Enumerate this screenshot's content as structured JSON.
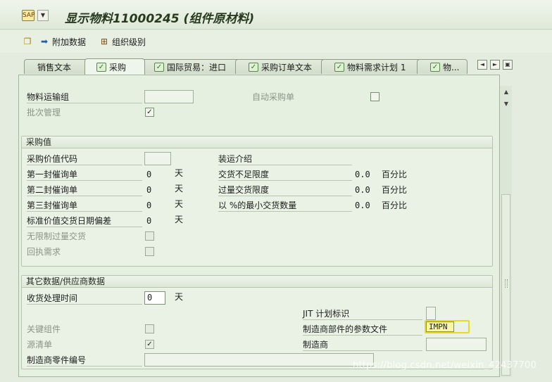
{
  "window": {
    "title": "显示物料11000245 (组件原材料)",
    "sys_icon": "sap-screen-icon",
    "sys_icon_glyph": "SAP"
  },
  "toolbar": {
    "items": [
      {
        "label": "",
        "icon": "copy-icon"
      },
      {
        "label": "附加数据",
        "icon": "arrow-right-icon"
      },
      {
        "label": "组织级别",
        "icon": "org-levels-icon"
      }
    ]
  },
  "tabs": [
    {
      "label": "销售文本",
      "checked": false
    },
    {
      "label": "采购",
      "checked": true,
      "active": true
    },
    {
      "label": "国际贸易：进口",
      "checked": true
    },
    {
      "label": "采购订单文本",
      "checked": true
    },
    {
      "label": "物料需求计划 1",
      "checked": true
    },
    {
      "label": "物...",
      "checked": true
    }
  ],
  "tab_nav": {
    "prev": "◄",
    "next": "►",
    "list": "▣"
  },
  "top_section": {
    "material_freight_group": {
      "label": "物料运输组",
      "value": ""
    },
    "auto_po": {
      "label": "自动采购单",
      "checked": false
    },
    "batch_mgmt": {
      "label": "批次管理",
      "checked": true
    }
  },
  "purchasing_values": {
    "title": "采购值",
    "pur_value_key": {
      "label": "采购价值代码",
      "value": ""
    },
    "reminder1": {
      "label": "第一封催询单",
      "value": "0",
      "unit": "天"
    },
    "reminder2": {
      "label": "第二封催询单",
      "value": "0",
      "unit": "天"
    },
    "reminder3": {
      "label": "第三封催询单",
      "value": "0",
      "unit": "天"
    },
    "std_deviation": {
      "label": "标准价值交货日期偏差",
      "value": "0",
      "unit": "天"
    },
    "unlimited_overdelivery": {
      "label": "无限制过量交货",
      "checked": false
    },
    "ack_required": {
      "label": "回执需求",
      "checked": false
    },
    "shipping_instr": {
      "label": "装运介绍"
    },
    "underdelivery_tol": {
      "label": "交货不足限度",
      "value": "0.0",
      "unit": "百分比"
    },
    "overdelivery_tol": {
      "label": "过量交货限度",
      "value": "0.0",
      "unit": "百分比"
    },
    "min_delivery_qty": {
      "label": "以 %的最小交货数量",
      "value": "0.0",
      "unit": "百分比"
    }
  },
  "other_data": {
    "title": "其它数据/供应商数据",
    "gr_processing_time": {
      "label": "收货处理时间",
      "value": "0",
      "unit": "天"
    },
    "jit_indicator": {
      "label": "JIT 计划标识",
      "value": ""
    },
    "critical_part": {
      "label": "关键组件",
      "checked": false
    },
    "mfr_part_profile": {
      "label": "制造商部件的参数文件",
      "value": "IMPN"
    },
    "source_list": {
      "label": "源清单",
      "checked": true
    },
    "manufacturer": {
      "label": "制造商",
      "value": ""
    },
    "mfr_part_number": {
      "label": "制造商零件编号",
      "value": ""
    }
  },
  "checkmark": "✓",
  "scroll": {
    "up": "▲",
    "down": "▼"
  },
  "watermark": "https://blog.csdn.net/weixin_42437700"
}
